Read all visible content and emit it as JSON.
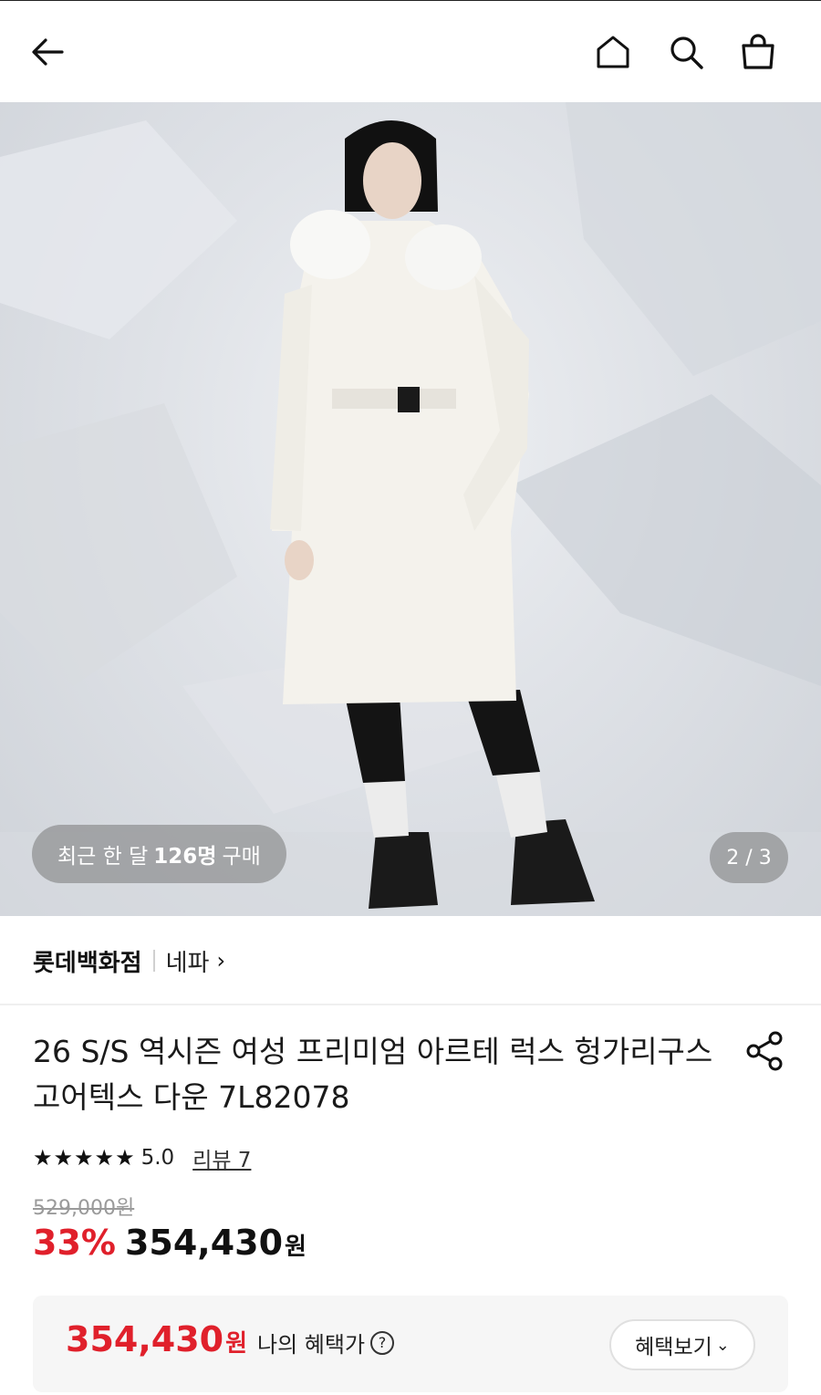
{
  "header": {
    "back_icon": "arrow-left-icon",
    "home_icon": "home-icon",
    "search_icon": "search-icon",
    "cart_icon": "shopping-bag-icon"
  },
  "gallery": {
    "purchase_prefix": "최근 한 달",
    "purchase_count": "126명",
    "purchase_suffix": "구매",
    "page_indicator": "2 / 3"
  },
  "brand": {
    "store": "롯데백화점",
    "name": "네파",
    "chevron": "›"
  },
  "product": {
    "title": "26 S/S 역시즌 여성 프리미엄 아르테 럭스 헝가리구스 고어텍스 다운 7L82078",
    "share_icon": "share-icon",
    "stars": "★★★★★",
    "rating": "5.0",
    "review_link": "리뷰 7",
    "original_price": "529,000원",
    "discount_rate": "33%",
    "sale_price": "354,430",
    "currency": "원"
  },
  "benefit": {
    "price": "354,430",
    "currency": "원",
    "label": "나의 혜택가",
    "help_icon": "?",
    "button_label": "혜택보기",
    "button_chevron": "⌄"
  },
  "colors": {
    "accent_red": "#e0202b",
    "text_dark": "#111111",
    "muted": "#9a9a9a",
    "benefit_bg": "#f6f6f6"
  }
}
